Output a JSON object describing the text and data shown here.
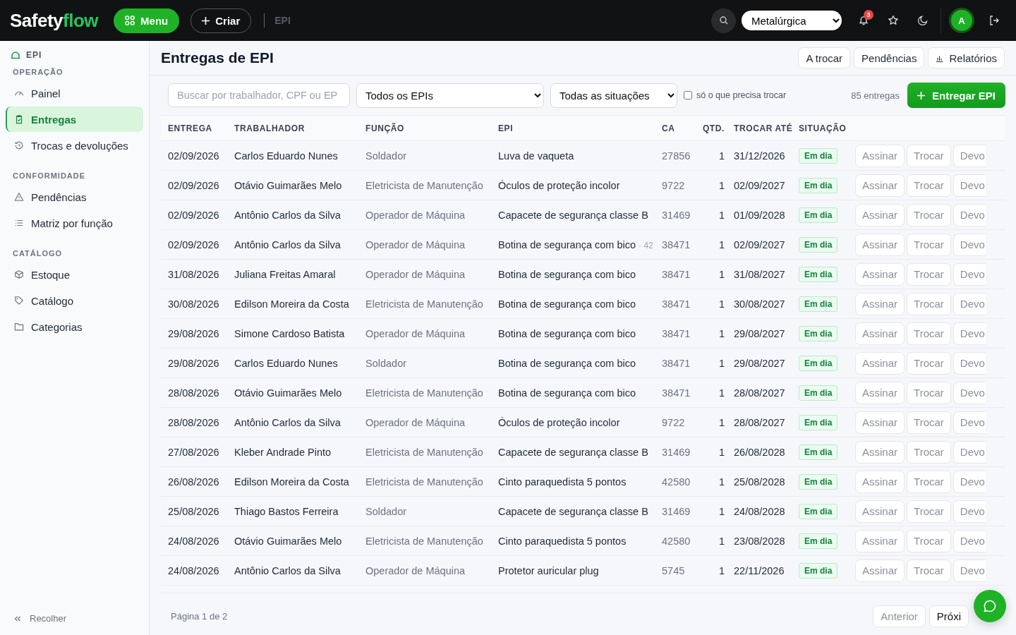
{
  "topbar": {
    "logo": {
      "part1": "Safety",
      "part2": "flow"
    },
    "menu_button": "Menu",
    "create_button": "Criar",
    "breadcrumb": "EPI",
    "company_select": "Metalúrgica",
    "notifications_badge": "3",
    "avatar": "A"
  },
  "sidebar": {
    "module": "EPI",
    "groups": [
      {
        "title": "OPERAÇÃO",
        "items": [
          {
            "label": "Painel",
            "selected": false
          },
          {
            "label": "Entregas",
            "selected": true
          },
          {
            "label": "Trocas e devoluções",
            "selected": false
          }
        ]
      },
      {
        "title": "CONFORMIDADE",
        "items": [
          {
            "label": "Pendências",
            "selected": false
          },
          {
            "label": "Matriz por função",
            "selected": false
          }
        ]
      },
      {
        "title": "CATÁLOGO",
        "items": [
          {
            "label": "Estoque",
            "selected": false
          },
          {
            "label": "Catálogo",
            "selected": false
          },
          {
            "label": "Categorias",
            "selected": false
          }
        ]
      }
    ],
    "collapse": "Recolher"
  },
  "page": {
    "title": "Entregas de EPI",
    "header_buttons": [
      "A trocar",
      "Pendências",
      "Relatórios"
    ]
  },
  "filters": {
    "search": {
      "placeholder": "Buscar por trabalhador, CPF ou EP"
    },
    "epi_select": "Todos os EPIs",
    "status_select": "Todas as situações",
    "only_to_replace": {
      "label": "só o que precisa trocar",
      "checked": false
    },
    "count": "85 entregas",
    "primary_button": "Entregar EPI"
  },
  "table": {
    "columns": [
      "ENTREGA",
      "TRABALHADOR",
      "FUNÇÃO",
      "EPI",
      "CA",
      "QTD.",
      "TROCAR ATÉ",
      "SITUAÇÃO"
    ],
    "rows": [
      {
        "date": "02/09/2026",
        "worker": "Carlos Eduardo Nunes",
        "role": "Soldador",
        "epi": "Luva de vaqueta",
        "ca": "27856",
        "qty": "1",
        "until": "31/12/2026",
        "status": {
          "label": "Em dia",
          "kind": "ok"
        },
        "actions": [
          "Assinar",
          "Trocar",
          "Devo"
        ]
      },
      {
        "date": "02/09/2026",
        "worker": "Otávio Guimarães Melo",
        "role": "Eletricista de Manutenção",
        "epi": "Óculos de proteção incolor",
        "ca": "9722",
        "qty": "1",
        "until": "02/09/2027",
        "status": {
          "label": "Em dia",
          "kind": "ok"
        },
        "actions": [
          "Assinar",
          "Trocar",
          "Devo"
        ]
      },
      {
        "date": "02/09/2026",
        "worker": "Antônio Carlos da Silva",
        "role": "Operador de Máquina",
        "epi": "Capacete de segurança classe B",
        "ca": "31469",
        "qty": "1",
        "until": "01/09/2028",
        "status": {
          "label": "Em dia",
          "kind": "ok"
        },
        "actions": [
          "Assinar",
          "Trocar",
          "Devo"
        ]
      },
      {
        "date": "02/09/2026",
        "worker": "Antônio Carlos da Silva",
        "role": "Operador de Máquina",
        "epi": "Botina de segurança com bico",
        "epi_note": "· 42",
        "ca": "38471",
        "qty": "1",
        "until": "02/09/2027",
        "status": {
          "label": "Em dia",
          "kind": "ok"
        },
        "actions": [
          "Assinar",
          "Trocar",
          "Devo"
        ]
      },
      {
        "date": "31/08/2026",
        "worker": "Juliana Freitas Amaral",
        "role": "Operador de Máquina",
        "epi": "Botina de segurança com bico",
        "ca": "38471",
        "qty": "1",
        "until": "31/08/2027",
        "status": {
          "label": "Em dia",
          "kind": "ok"
        },
        "actions": [
          "Assinar",
          "Trocar",
          "Devo"
        ]
      },
      {
        "date": "30/08/2026",
        "worker": "Edilson Moreira da Costa",
        "role": "Eletricista de Manutenção",
        "epi": "Botina de segurança com bico",
        "ca": "38471",
        "qty": "1",
        "until": "30/08/2027",
        "status": {
          "label": "Em dia",
          "kind": "ok"
        },
        "actions": [
          "Assinar",
          "Trocar",
          "Devo"
        ]
      },
      {
        "date": "29/08/2026",
        "worker": "Simone Cardoso Batista",
        "role": "Operador de Máquina",
        "epi": "Botina de segurança com bico",
        "ca": "38471",
        "qty": "1",
        "until": "29/08/2027",
        "status": {
          "label": "Em dia",
          "kind": "ok"
        },
        "actions": [
          "Assinar",
          "Trocar",
          "Devo"
        ]
      },
      {
        "date": "29/08/2026",
        "worker": "Carlos Eduardo Nunes",
        "role": "Soldador",
        "epi": "Botina de segurança com bico",
        "ca": "38471",
        "qty": "1",
        "until": "29/08/2027",
        "status": {
          "label": "Em dia",
          "kind": "ok"
        },
        "actions": [
          "Assinar",
          "Trocar",
          "Devo"
        ]
      },
      {
        "date": "28/08/2026",
        "worker": "Otávio Guimarães Melo",
        "role": "Eletricista de Manutenção",
        "epi": "Botina de segurança com bico",
        "ca": "38471",
        "qty": "1",
        "until": "28/08/2027",
        "status": {
          "label": "Em dia",
          "kind": "ok"
        },
        "actions": [
          "Assinar",
          "Trocar",
          "Devo"
        ]
      },
      {
        "date": "28/08/2026",
        "worker": "Antônio Carlos da Silva",
        "role": "Operador de Máquina",
        "epi": "Óculos de proteção incolor",
        "ca": "9722",
        "qty": "1",
        "until": "28/08/2027",
        "status": {
          "label": "Em dia",
          "kind": "ok"
        },
        "actions": [
          "Assinar",
          "Trocar",
          "Devo"
        ]
      },
      {
        "date": "27/08/2026",
        "worker": "Kleber Andrade Pinto",
        "role": "Eletricista de Manutenção",
        "epi": "Capacete de segurança classe B",
        "ca": "31469",
        "qty": "1",
        "until": "26/08/2028",
        "status": {
          "label": "Em dia",
          "kind": "ok"
        },
        "actions": [
          "Assinar",
          "Trocar",
          "Devo"
        ]
      },
      {
        "date": "26/08/2026",
        "worker": "Edilson Moreira da Costa",
        "role": "Eletricista de Manutenção",
        "epi": "Cinto paraquedista 5 pontos",
        "ca": "42580",
        "qty": "1",
        "until": "25/08/2028",
        "status": {
          "label": "Em dia",
          "kind": "ok"
        },
        "actions": [
          "Assinar",
          "Trocar",
          "Devo"
        ]
      },
      {
        "date": "25/08/2026",
        "worker": "Thiago Bastos Ferreira",
        "role": "Soldador",
        "epi": "Capacete de segurança classe B",
        "ca": "31469",
        "qty": "1",
        "until": "24/08/2028",
        "status": {
          "label": "Em dia",
          "kind": "ok"
        },
        "actions": [
          "Assinar",
          "Trocar",
          "Devo"
        ]
      },
      {
        "date": "24/08/2026",
        "worker": "Otávio Guimarães Melo",
        "role": "Eletricista de Manutenção",
        "epi": "Cinto paraquedista 5 pontos",
        "ca": "42580",
        "qty": "1",
        "until": "23/08/2028",
        "status": {
          "label": "Em dia",
          "kind": "ok"
        },
        "actions": [
          "Assinar",
          "Trocar",
          "Devo"
        ]
      },
      {
        "date": "24/08/2026",
        "worker": "Antônio Carlos da Silva",
        "role": "Operador de Máquina",
        "epi": "Protetor auricular plug",
        "ca": "5745",
        "qty": "1",
        "until": "22/11/2026",
        "status": {
          "label": "Em dia",
          "kind": "ok"
        },
        "actions": [
          "Assinar",
          "Trocar",
          "Devo"
        ]
      }
    ]
  },
  "pagination": {
    "label": "Página 1 de 2",
    "buttons": [
      {
        "label": "Anterior",
        "disabled": true
      },
      {
        "label": "Próxi",
        "disabled": false
      }
    ]
  }
}
